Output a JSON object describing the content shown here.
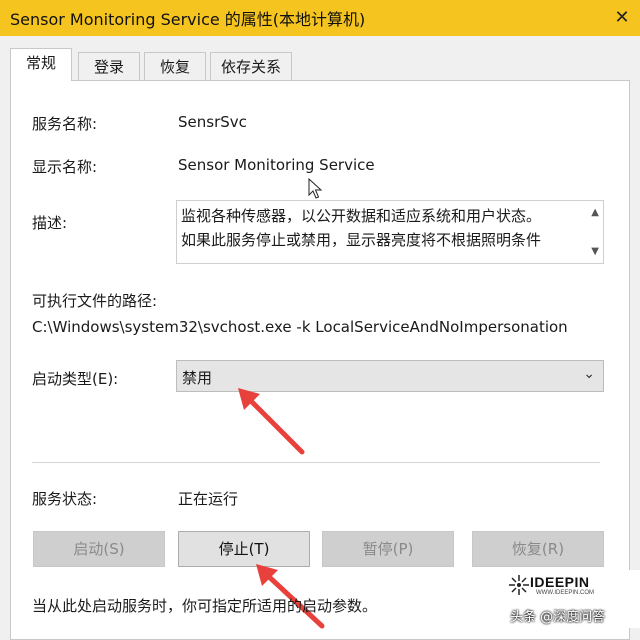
{
  "window": {
    "title": "Sensor Monitoring Service 的属性(本地计算机)",
    "close_glyph": "✕"
  },
  "tabs": [
    {
      "label": "常规"
    },
    {
      "label": "登录"
    },
    {
      "label": "恢复"
    },
    {
      "label": "依存关系"
    }
  ],
  "general": {
    "service_name_label": "服务名称:",
    "service_name": "SensrSvc",
    "display_name_label": "显示名称:",
    "display_name": "Sensor Monitoring Service",
    "description_label": "描述:",
    "description_lines": [
      "监视各种传感器，以公开数据和适应系统和用户状态。",
      "如果此服务停止或禁用，显示器亮度将不根据照明条件"
    ],
    "path_label": "可执行文件的路径:",
    "path": "C:\\Windows\\system32\\svchost.exe -k LocalServiceAndNoImpersonation",
    "startup_type_label": "启动类型(E):",
    "startup_type": "禁用",
    "status_label": "服务状态:",
    "status": "正在运行",
    "buttons": {
      "start": "启动(S)",
      "stop": "停止(T)",
      "pause": "暂停(P)",
      "resume": "恢复(R)"
    },
    "hint": "当从此处启动服务时，你可指定所适用的启动参数。"
  },
  "watermark": {
    "logo": "IDEEPIN",
    "sub": "WWW.IDEEPIN.COM",
    "caption": "头条 @深度问答"
  },
  "colors": {
    "titlebar": "#f6c41e",
    "annotation_arrow": "#e8413b"
  }
}
